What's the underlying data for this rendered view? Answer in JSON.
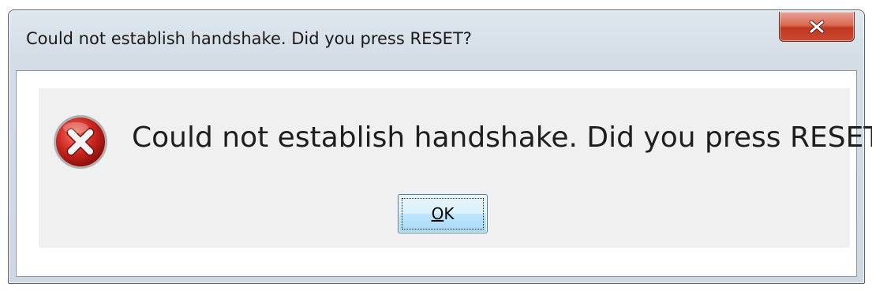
{
  "window": {
    "title": "Could not establish handshake. Did you press RESET?",
    "close_icon": "close-icon"
  },
  "dialog": {
    "icon": "error-icon",
    "message": "Could not establish handshake. Did you press RESET?",
    "ok_button": {
      "mnemonic": "O",
      "rest": "K"
    }
  },
  "colors": {
    "close_button_red": "#c1371f",
    "error_icon_red": "#c8201c",
    "ok_button_border": "#3c7fb1"
  }
}
